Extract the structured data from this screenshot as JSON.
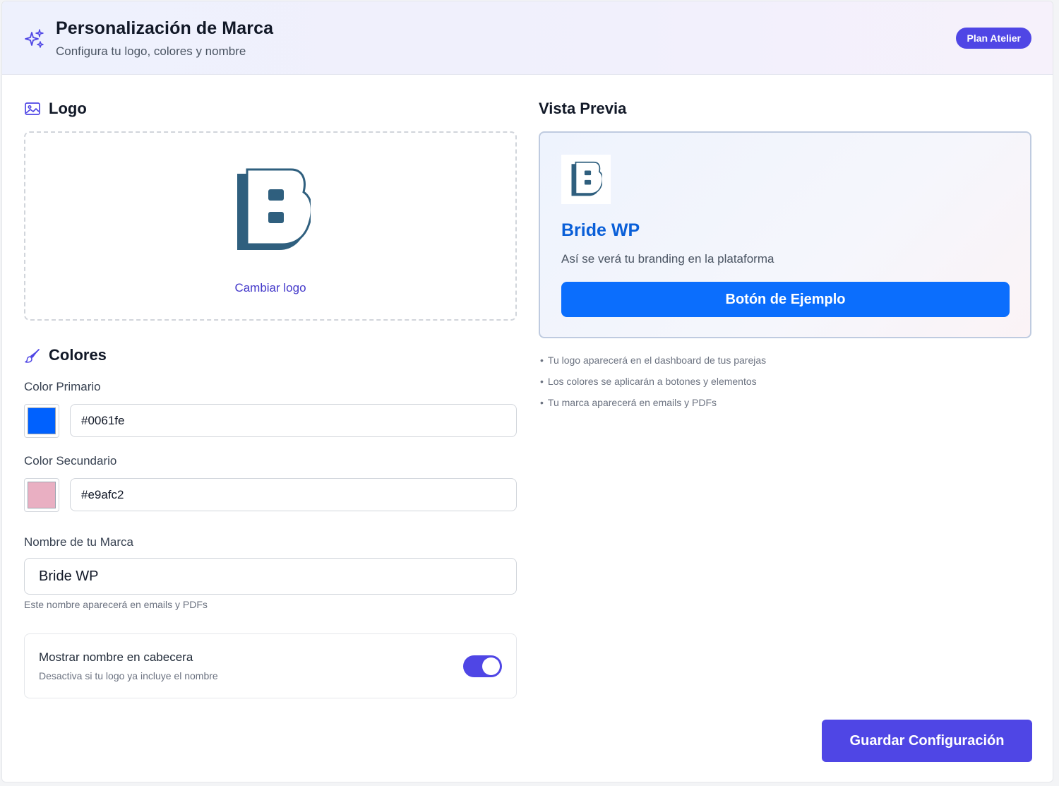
{
  "header": {
    "title": "Personalización de Marca",
    "subtitle": "Configura tu logo, colores y nombre",
    "plan_badge": "Plan Atelier",
    "icon": "sparkles-icon"
  },
  "logo_section": {
    "title": "Logo",
    "icon": "image-icon",
    "change_label": "Cambiar logo",
    "logo_letter": "B"
  },
  "colors_section": {
    "title": "Colores",
    "icon": "paintbrush-icon",
    "primary": {
      "label": "Color Primario",
      "value": "#0061fe",
      "swatch": "#0061fe"
    },
    "secondary": {
      "label": "Color Secundario",
      "value": "#e9afc2",
      "swatch": "#e9afc2"
    }
  },
  "brand_name": {
    "label": "Nombre de tu Marca",
    "value": "Bride WP",
    "help": "Este nombre aparecerá en emails y PDFs"
  },
  "header_toggle": {
    "title": "Mostrar nombre en cabecera",
    "subtitle": "Desactiva si tu logo ya incluye el nombre",
    "enabled": true
  },
  "preview": {
    "title": "Vista Previa",
    "brand": "Bride WP",
    "description": "Así se verá tu branding en la plataforma",
    "button_label": "Botón de Ejemplo",
    "notes": [
      "Tu logo aparecerá en el dashboard de tus parejas",
      "Los colores se aplicarán a botones y elementos",
      "Tu marca aparecerá en emails y PDFs"
    ]
  },
  "save_label": "Guardar Configuración",
  "colors": {
    "accent": "#4f46e5",
    "logo": "#2f5f7e",
    "preview_button": "#0b6efd"
  }
}
